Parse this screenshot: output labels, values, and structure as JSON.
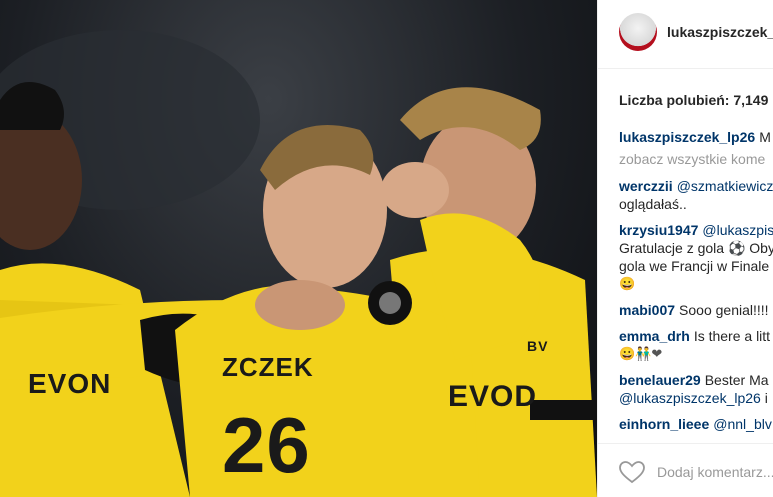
{
  "post": {
    "jersey_sponsor": "EVON",
    "jersey_sponsor_right": "EVOD",
    "jersey_name": "ZCZEK",
    "jersey_number": "26",
    "badge": "BV"
  },
  "panel": {
    "username": "lukaszpiszczek_",
    "likes_label": "Liczba polubień:",
    "likes_count": "7,149",
    "caption_user": "lukaszpiszczek_lp26",
    "caption_text": "M",
    "view_all": "zobacz wszystkie kome",
    "comments": [
      {
        "user": "werczzii",
        "mention": "@szmatkiewicz",
        "line2": "oglądałaś.."
      },
      {
        "user": "krzysiu1947",
        "mention": "@lukaszpis",
        "line2": "Gratulacje z gola ⚽ Oby",
        "line3": "gola we Francji w Finale",
        "line4": "😀"
      },
      {
        "user": "mabi007",
        "text": "Sooo genial!!!!"
      },
      {
        "user": "emma_drh",
        "text": "Is there a litt",
        "line2": "😀👬❤"
      },
      {
        "user": "benelauer29",
        "text": "Bester Ma",
        "line2_mention": "@lukaszpiszczek_lp26",
        "line2_text": "i"
      },
      {
        "user": "einhorn_lieee",
        "mention": "@nnl_blv"
      }
    ],
    "add_comment_placeholder": "Dodaj komentarz..."
  },
  "icons": {
    "heart": "heart-icon",
    "avatar": "avatar"
  },
  "colors": {
    "username": "#003569",
    "text": "#262626",
    "muted": "#999999",
    "jersey_yellow": "#f2d21b"
  }
}
